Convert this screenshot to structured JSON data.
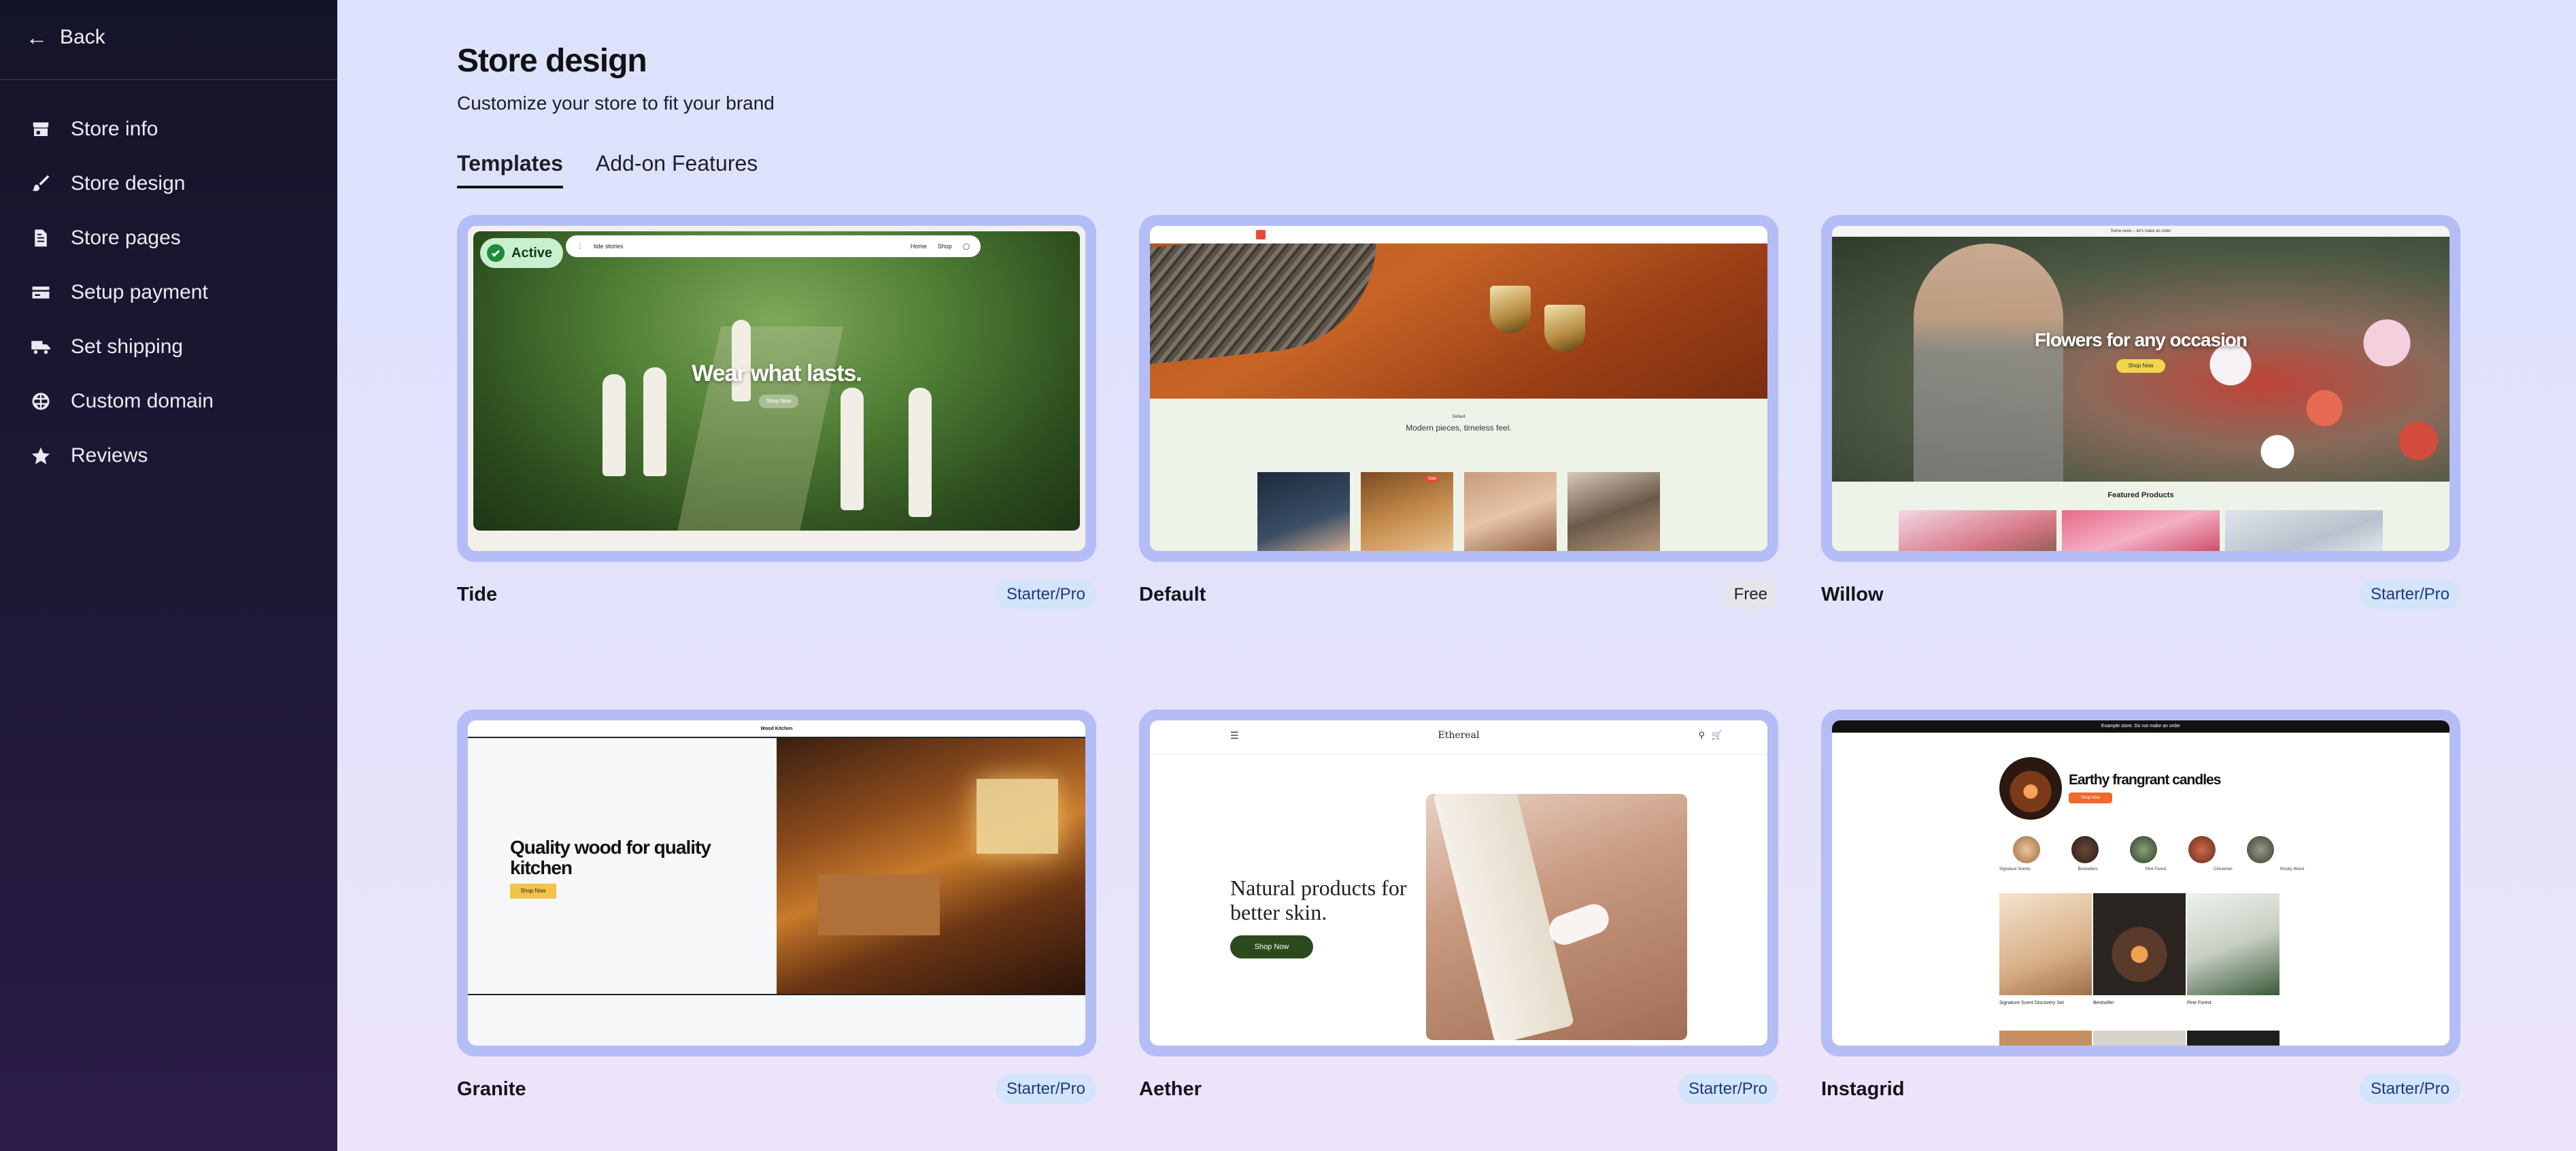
{
  "sidebar": {
    "back_label": "Back",
    "items": [
      {
        "label": "Store info",
        "icon": "store-icon"
      },
      {
        "label": "Store design",
        "icon": "brush-icon"
      },
      {
        "label": "Store pages",
        "icon": "page-icon"
      },
      {
        "label": "Setup payment",
        "icon": "credit-card-icon"
      },
      {
        "label": "Set shipping",
        "icon": "truck-icon"
      },
      {
        "label": "Custom domain",
        "icon": "globe-icon"
      },
      {
        "label": "Reviews",
        "icon": "star-icon"
      }
    ]
  },
  "header": {
    "title": "Store design",
    "subtitle": "Customize your store to fit your brand"
  },
  "tabs": [
    {
      "label": "Templates",
      "active": true
    },
    {
      "label": "Add-on Features",
      "active": false
    }
  ],
  "templates": [
    {
      "name": "Tide",
      "badge": "Starter/Pro",
      "active": true,
      "active_label": "Active",
      "preview": {
        "headline": "Wear what lasts.",
        "button": "Shop Now",
        "nav_brand": "tide stories",
        "nav_links": [
          "Home",
          "Shop"
        ]
      }
    },
    {
      "name": "Default",
      "badge": "Free",
      "preview": {
        "small_label": "Default",
        "caption": "Modern pieces, timeless feel.",
        "sale_tag": "Sale"
      }
    },
    {
      "name": "Willow",
      "badge": "Starter/Pro",
      "preview": {
        "banner": "Some news – let's make an order",
        "headline": "Flowers for any occasion",
        "button": "Shop Now",
        "featured": "Featured Products"
      }
    },
    {
      "name": "Granite",
      "badge": "Starter/Pro",
      "preview": {
        "brand": "Wood Kitchen",
        "headline": "Quality wood for quality kitchen",
        "button": "Shop Now"
      }
    },
    {
      "name": "Aether",
      "badge": "Starter/Pro",
      "preview": {
        "brand": "Ethereal",
        "headline": "Natural products for better skin.",
        "button": "Shop Now"
      }
    },
    {
      "name": "Instagrid",
      "badge": "Starter/Pro",
      "preview": {
        "banner": "Example store: Do not make an order",
        "headline": "Earthy frangrant candles",
        "button": "Shop Now",
        "circle_labels": [
          "Signature Scents",
          "Bestsellers",
          "Pine Forest",
          "Cinnamon",
          "Smoky Wood"
        ],
        "tile_labels": [
          "Signature Scent Discovery Set",
          "Bestseller",
          "Pine Forest"
        ]
      }
    }
  ],
  "colors": {
    "sidebar_bg": "#141429",
    "main_bg": "#dde3fb",
    "card_frame": "#b4bdf6",
    "badge_pro_bg": "#d3e4fb",
    "badge_free_bg": "#e5e5ea",
    "active_bg": "#c8f0cf",
    "active_check": "#1f8a3c"
  }
}
